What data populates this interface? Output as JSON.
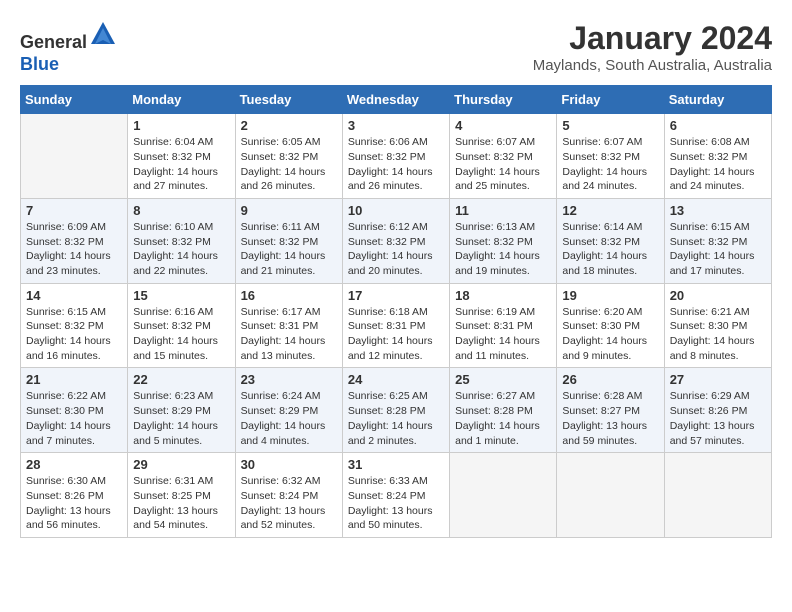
{
  "header": {
    "logo_general": "General",
    "logo_blue": "Blue",
    "month_year": "January 2024",
    "location": "Maylands, South Australia, Australia"
  },
  "weekdays": [
    "Sunday",
    "Monday",
    "Tuesday",
    "Wednesday",
    "Thursday",
    "Friday",
    "Saturday"
  ],
  "weeks": [
    [
      {
        "day": "",
        "empty": true
      },
      {
        "day": "1",
        "sunrise": "Sunrise: 6:04 AM",
        "sunset": "Sunset: 8:32 PM",
        "daylight": "Daylight: 14 hours and 27 minutes."
      },
      {
        "day": "2",
        "sunrise": "Sunrise: 6:05 AM",
        "sunset": "Sunset: 8:32 PM",
        "daylight": "Daylight: 14 hours and 26 minutes."
      },
      {
        "day": "3",
        "sunrise": "Sunrise: 6:06 AM",
        "sunset": "Sunset: 8:32 PM",
        "daylight": "Daylight: 14 hours and 26 minutes."
      },
      {
        "day": "4",
        "sunrise": "Sunrise: 6:07 AM",
        "sunset": "Sunset: 8:32 PM",
        "daylight": "Daylight: 14 hours and 25 minutes."
      },
      {
        "day": "5",
        "sunrise": "Sunrise: 6:07 AM",
        "sunset": "Sunset: 8:32 PM",
        "daylight": "Daylight: 14 hours and 24 minutes."
      },
      {
        "day": "6",
        "sunrise": "Sunrise: 6:08 AM",
        "sunset": "Sunset: 8:32 PM",
        "daylight": "Daylight: 14 hours and 24 minutes."
      }
    ],
    [
      {
        "day": "7",
        "sunrise": "Sunrise: 6:09 AM",
        "sunset": "Sunset: 8:32 PM",
        "daylight": "Daylight: 14 hours and 23 minutes."
      },
      {
        "day": "8",
        "sunrise": "Sunrise: 6:10 AM",
        "sunset": "Sunset: 8:32 PM",
        "daylight": "Daylight: 14 hours and 22 minutes."
      },
      {
        "day": "9",
        "sunrise": "Sunrise: 6:11 AM",
        "sunset": "Sunset: 8:32 PM",
        "daylight": "Daylight: 14 hours and 21 minutes."
      },
      {
        "day": "10",
        "sunrise": "Sunrise: 6:12 AM",
        "sunset": "Sunset: 8:32 PM",
        "daylight": "Daylight: 14 hours and 20 minutes."
      },
      {
        "day": "11",
        "sunrise": "Sunrise: 6:13 AM",
        "sunset": "Sunset: 8:32 PM",
        "daylight": "Daylight: 14 hours and 19 minutes."
      },
      {
        "day": "12",
        "sunrise": "Sunrise: 6:14 AM",
        "sunset": "Sunset: 8:32 PM",
        "daylight": "Daylight: 14 hours and 18 minutes."
      },
      {
        "day": "13",
        "sunrise": "Sunrise: 6:15 AM",
        "sunset": "Sunset: 8:32 PM",
        "daylight": "Daylight: 14 hours and 17 minutes."
      }
    ],
    [
      {
        "day": "14",
        "sunrise": "Sunrise: 6:15 AM",
        "sunset": "Sunset: 8:32 PM",
        "daylight": "Daylight: 14 hours and 16 minutes."
      },
      {
        "day": "15",
        "sunrise": "Sunrise: 6:16 AM",
        "sunset": "Sunset: 8:32 PM",
        "daylight": "Daylight: 14 hours and 15 minutes."
      },
      {
        "day": "16",
        "sunrise": "Sunrise: 6:17 AM",
        "sunset": "Sunset: 8:31 PM",
        "daylight": "Daylight: 14 hours and 13 minutes."
      },
      {
        "day": "17",
        "sunrise": "Sunrise: 6:18 AM",
        "sunset": "Sunset: 8:31 PM",
        "daylight": "Daylight: 14 hours and 12 minutes."
      },
      {
        "day": "18",
        "sunrise": "Sunrise: 6:19 AM",
        "sunset": "Sunset: 8:31 PM",
        "daylight": "Daylight: 14 hours and 11 minutes."
      },
      {
        "day": "19",
        "sunrise": "Sunrise: 6:20 AM",
        "sunset": "Sunset: 8:30 PM",
        "daylight": "Daylight: 14 hours and 9 minutes."
      },
      {
        "day": "20",
        "sunrise": "Sunrise: 6:21 AM",
        "sunset": "Sunset: 8:30 PM",
        "daylight": "Daylight: 14 hours and 8 minutes."
      }
    ],
    [
      {
        "day": "21",
        "sunrise": "Sunrise: 6:22 AM",
        "sunset": "Sunset: 8:30 PM",
        "daylight": "Daylight: 14 hours and 7 minutes."
      },
      {
        "day": "22",
        "sunrise": "Sunrise: 6:23 AM",
        "sunset": "Sunset: 8:29 PM",
        "daylight": "Daylight: 14 hours and 5 minutes."
      },
      {
        "day": "23",
        "sunrise": "Sunrise: 6:24 AM",
        "sunset": "Sunset: 8:29 PM",
        "daylight": "Daylight: 14 hours and 4 minutes."
      },
      {
        "day": "24",
        "sunrise": "Sunrise: 6:25 AM",
        "sunset": "Sunset: 8:28 PM",
        "daylight": "Daylight: 14 hours and 2 minutes."
      },
      {
        "day": "25",
        "sunrise": "Sunrise: 6:27 AM",
        "sunset": "Sunset: 8:28 PM",
        "daylight": "Daylight: 14 hours and 1 minute."
      },
      {
        "day": "26",
        "sunrise": "Sunrise: 6:28 AM",
        "sunset": "Sunset: 8:27 PM",
        "daylight": "Daylight: 13 hours and 59 minutes."
      },
      {
        "day": "27",
        "sunrise": "Sunrise: 6:29 AM",
        "sunset": "Sunset: 8:26 PM",
        "daylight": "Daylight: 13 hours and 57 minutes."
      }
    ],
    [
      {
        "day": "28",
        "sunrise": "Sunrise: 6:30 AM",
        "sunset": "Sunset: 8:26 PM",
        "daylight": "Daylight: 13 hours and 56 minutes."
      },
      {
        "day": "29",
        "sunrise": "Sunrise: 6:31 AM",
        "sunset": "Sunset: 8:25 PM",
        "daylight": "Daylight: 13 hours and 54 minutes."
      },
      {
        "day": "30",
        "sunrise": "Sunrise: 6:32 AM",
        "sunset": "Sunset: 8:24 PM",
        "daylight": "Daylight: 13 hours and 52 minutes."
      },
      {
        "day": "31",
        "sunrise": "Sunrise: 6:33 AM",
        "sunset": "Sunset: 8:24 PM",
        "daylight": "Daylight: 13 hours and 50 minutes."
      },
      {
        "day": "",
        "empty": true
      },
      {
        "day": "",
        "empty": true
      },
      {
        "day": "",
        "empty": true
      }
    ]
  ]
}
